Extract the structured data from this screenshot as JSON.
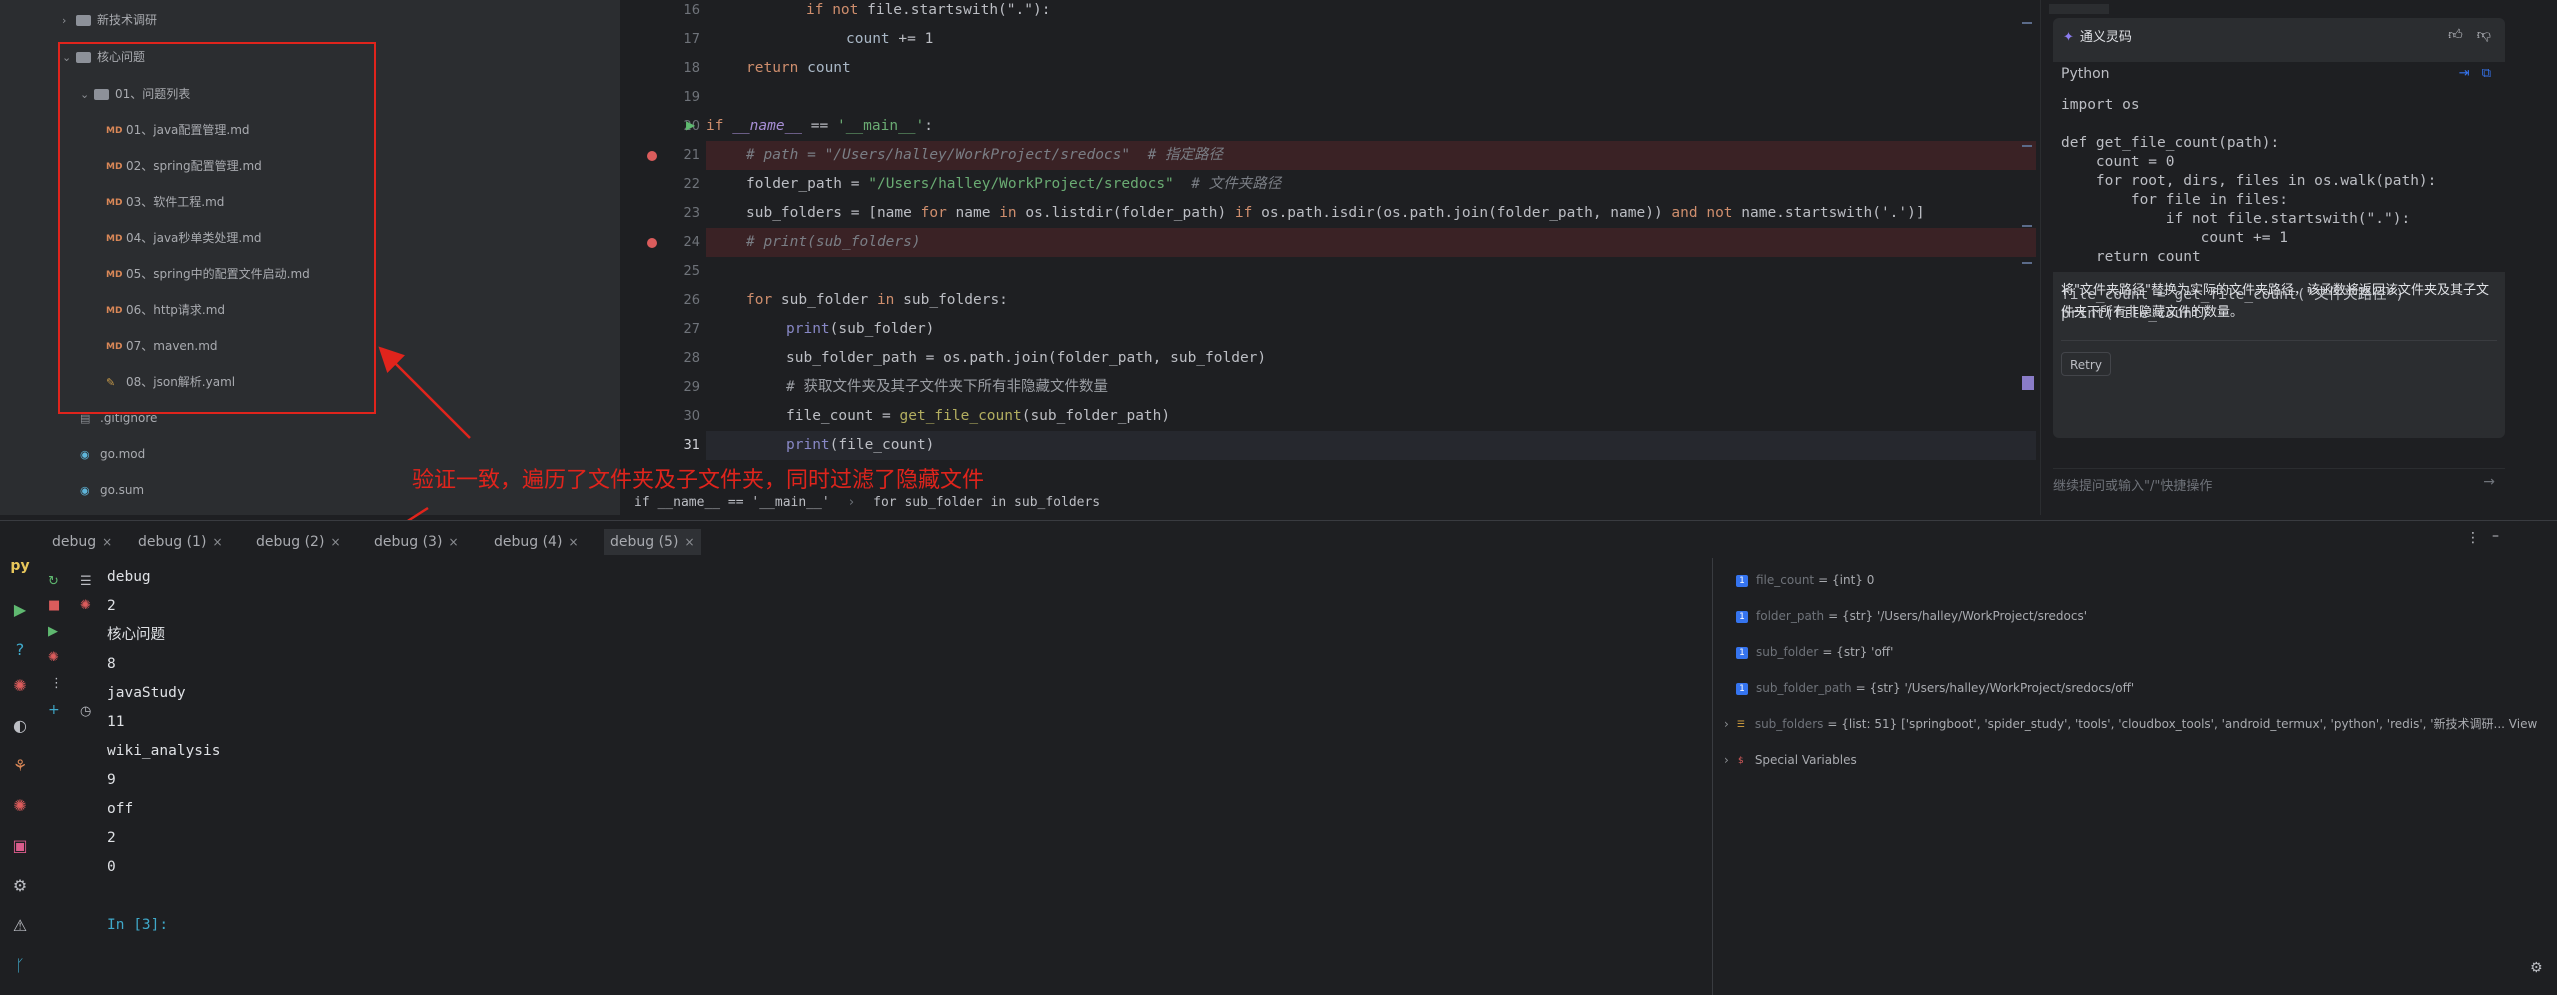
{
  "project_tree": {
    "items": [
      {
        "label": "新技术调研",
        "kind": "folder",
        "chev": ">"
      },
      {
        "label": "核心问题",
        "kind": "folder",
        "chev": "v"
      },
      {
        "label": "01、问题列表",
        "kind": "folder",
        "chev": "v"
      },
      {
        "label": "01、java配置管理.md",
        "kind": "md"
      },
      {
        "label": "02、spring配置管理.md",
        "kind": "md"
      },
      {
        "label": "03、软件工程.md",
        "kind": "md"
      },
      {
        "label": "04、java秒单类处理.md",
        "kind": "md"
      },
      {
        "label": "05、spring中的配置文件启动.md",
        "kind": "md"
      },
      {
        "label": "06、http请求.md",
        "kind": "md"
      },
      {
        "label": "07、maven.md",
        "kind": "md"
      },
      {
        "label": "08、json解析.yaml",
        "kind": "yaml"
      },
      {
        "label": ".gitignore",
        "kind": "file"
      },
      {
        "label": "go.mod",
        "kind": "go"
      },
      {
        "label": "go.sum",
        "kind": "go"
      }
    ],
    "md_icon": "MD",
    "yaml_icon": "yaml-icon"
  },
  "editor": {
    "line_numbers": [
      "16",
      "17",
      "18",
      "19",
      "20",
      "21",
      "22",
      "23",
      "24",
      "25",
      "26",
      "27",
      "28",
      "29",
      "30",
      "31"
    ],
    "lines": [
      {
        "segs": [
          {
            "t": "if not ",
            "c": "kw"
          },
          {
            "t": "file.startswith(\".\"):",
            "c": "id"
          }
        ]
      },
      {
        "segs": [
          {
            "t": "count ",
            "c": "pm"
          },
          {
            "t": "+= 1",
            "c": "id"
          }
        ]
      },
      {
        "segs": [
          {
            "t": "return ",
            "c": "kw"
          },
          {
            "t": "count",
            "c": "pm"
          }
        ]
      },
      {
        "segs": []
      },
      {
        "segs": [
          {
            "t": "if ",
            "c": "kw"
          },
          {
            "t": "__name__",
            "c": "it"
          },
          {
            "t": " == ",
            "c": "id"
          },
          {
            "t": "'__main__'",
            "c": "str"
          },
          {
            "t": ":",
            "c": "id"
          }
        ]
      },
      {
        "segs": [
          {
            "t": "# path = \"/Users/halley/WorkProject/sredocs\"  # 指定路径",
            "c": "cm"
          }
        ]
      },
      {
        "segs": [
          {
            "t": "folder_path ",
            "c": "id"
          },
          {
            "t": "= ",
            "c": "id"
          },
          {
            "t": "\"/Users/halley/WorkProject/sredocs\"",
            "c": "str"
          },
          {
            "t": "  # 文件夹路径",
            "c": "cm"
          }
        ]
      },
      {
        "segs": [
          {
            "t": "sub_folders = [name ",
            "c": "id"
          },
          {
            "t": "for ",
            "c": "kw"
          },
          {
            "t": "name ",
            "c": "id"
          },
          {
            "t": "in ",
            "c": "kw"
          },
          {
            "t": "os.listdir(folder_path) ",
            "c": "id"
          },
          {
            "t": "if ",
            "c": "kw"
          },
          {
            "t": "os.path.isdir(os.path.join(folder_path, name)) ",
            "c": "id"
          },
          {
            "t": "and not ",
            "c": "kw"
          },
          {
            "t": "name.startswith('.')]",
            "c": "id"
          }
        ]
      },
      {
        "segs": [
          {
            "t": "# print(sub_folders)",
            "c": "cm"
          }
        ]
      },
      {
        "segs": []
      },
      {
        "segs": [
          {
            "t": "for ",
            "c": "kw"
          },
          {
            "t": "sub_folder ",
            "c": "id"
          },
          {
            "t": "in ",
            "c": "kw"
          },
          {
            "t": "sub_folders:",
            "c": "id"
          }
        ]
      },
      {
        "segs": [
          {
            "t": "print",
            "c": "bi"
          },
          {
            "t": "(sub_folder)",
            "c": "id"
          }
        ]
      },
      {
        "segs": [
          {
            "t": "sub_folder_path = os.path.join(folder_path, sub_folder)",
            "c": "id"
          }
        ]
      },
      {
        "segs": [
          {
            "t": "# 获取文件夹及其子文件夹下所有非隐藏文件数量",
            "c": "gr"
          }
        ]
      },
      {
        "segs": [
          {
            "t": "file_count = ",
            "c": "id"
          },
          {
            "t": "get_file_count",
            "c": "dec"
          },
          {
            "t": "(sub_folder_path)",
            "c": "id"
          }
        ]
      },
      {
        "segs": [
          {
            "t": "print",
            "c": "bi"
          },
          {
            "t": "(file_count)",
            "c": "id"
          }
        ]
      }
    ],
    "breadcrumb": [
      "if __name__ == '__main__'",
      "for sub_folder in sub_folders"
    ]
  },
  "ai_panel": {
    "title": "通义灵码",
    "lang": "Python",
    "code": "import os\n\ndef get_file_count(path):\n    count = 0\n    for root, dirs, files in os.walk(path):\n        for file in files:\n            if not file.startswith(\".\"):\n                count += 1\n    return count\n\nfile_count = get_file_count(\"文件夹路径\")\nprint(file_count)",
    "explanation": "将\"文件夹路径\"替换为实际的文件夹路径，该函数将返回该文件夹及其子文件夹下所有非隐藏文件的数量。",
    "retry_label": "Retry",
    "input_placeholder": "继续提问或输入\"/\"快捷操作"
  },
  "annotation": "验证一致，遍历了文件夹及子文件夹，同时过滤了隐藏文件",
  "tabs": [
    {
      "label": "debug",
      "active": false
    },
    {
      "label": "debug (1)",
      "active": false
    },
    {
      "label": "debug (2)",
      "active": false
    },
    {
      "label": "debug (3)",
      "active": false
    },
    {
      "label": "debug (4)",
      "active": false
    },
    {
      "label": "debug (5)",
      "active": true
    }
  ],
  "console": {
    "lines": [
      "debug",
      "2",
      "核心问题",
      "8",
      "javaStudy",
      "11",
      "wiki_analysis",
      "9",
      "off",
      "2",
      "0",
      "",
      "In [3]:"
    ]
  },
  "variables": [
    {
      "name": "file_count",
      "value": "= {int} 0",
      "expandable": false
    },
    {
      "name": "folder_path",
      "value": "= {str} '/Users/halley/WorkProject/sredocs'",
      "expandable": false
    },
    {
      "name": "sub_folder",
      "value": "= {str} 'off'",
      "expandable": false
    },
    {
      "name": "sub_folder_path",
      "value": "= {str} '/Users/halley/WorkProject/sredocs/off'",
      "expandable": false
    },
    {
      "name": "sub_folders",
      "value": "= {list: 51} ['springboot', 'spider_study', 'tools', 'cloudbox_tools', 'android_termux', 'python', 'redis', '新技术调研... View",
      "expandable": true
    },
    {
      "name": "Special Variables",
      "value": "",
      "expandable": true
    }
  ],
  "colors": {
    "annotation_red": "#e0241c",
    "accent_blue": "#3574f0",
    "breakpoint_red": "#db5c5c"
  }
}
